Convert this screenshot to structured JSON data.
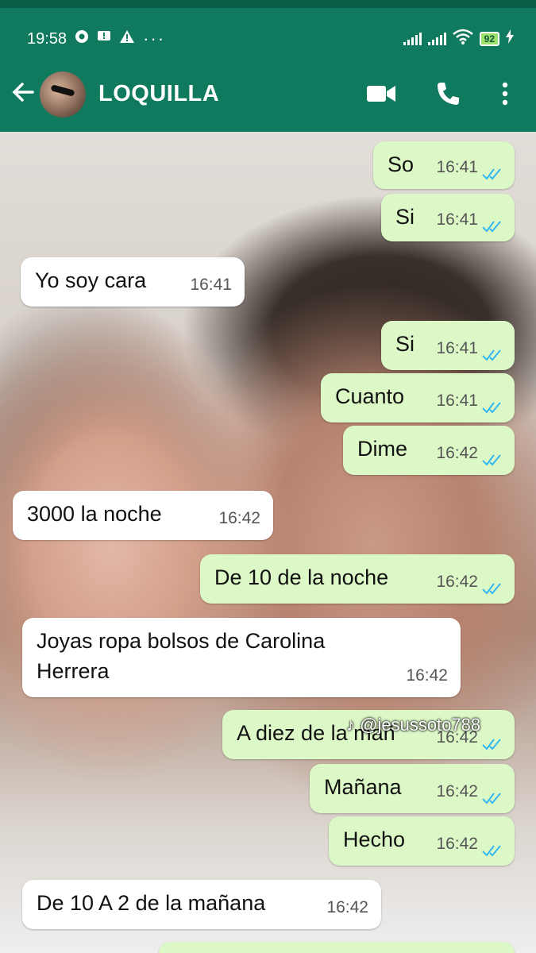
{
  "status_bar": {
    "time": "19:58",
    "battery": "92"
  },
  "header": {
    "contact_name": "LOQUILLA"
  },
  "messages": [
    {
      "dir": "out",
      "text": "So",
      "time": "16:41"
    },
    {
      "dir": "out",
      "text": "Si",
      "time": "16:41"
    },
    {
      "dir": "in",
      "text": "Yo soy cara",
      "time": "16:41"
    },
    {
      "dir": "out",
      "text": "Si",
      "time": "16:41"
    },
    {
      "dir": "out",
      "text": "Cuanto",
      "time": "16:41"
    },
    {
      "dir": "out",
      "text": "Dime",
      "time": "16:42"
    },
    {
      "dir": "in",
      "text": "3000 la noche",
      "time": "16:42"
    },
    {
      "dir": "out",
      "text": "De 10 de la noche",
      "time": "16:42"
    },
    {
      "dir": "in",
      "text": "Joyas ropa bolsos de Carolina",
      "text2": "Herrera",
      "time": "16:42"
    },
    {
      "dir": "out",
      "text": "A diez de la mañ",
      "time": "16:42"
    },
    {
      "dir": "out",
      "text": "Mañana",
      "time": "16:42"
    },
    {
      "dir": "out",
      "text": "Hecho",
      "time": "16:42"
    },
    {
      "dir": "in",
      "text": "De 10 A 2 de la mañana",
      "time": "16:42"
    }
  ],
  "watermark": "@jesussoto788",
  "colors": {
    "header": "#0f7a5e",
    "outgoing_bubble": "#dcf8c6",
    "incoming_bubble": "#ffffff",
    "read_ticks": "#34b7f1"
  }
}
